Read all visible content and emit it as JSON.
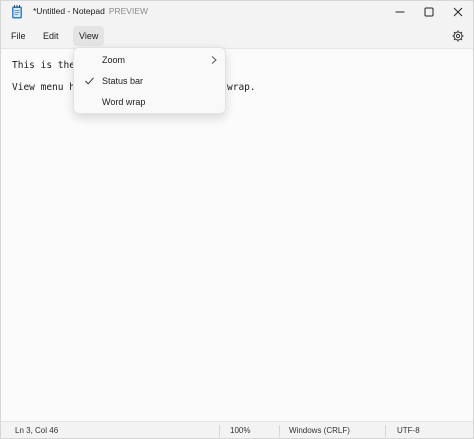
{
  "window": {
    "title": "*Untitled - Notepad",
    "preview_tag": "PREVIEW"
  },
  "menubar": {
    "file": "File",
    "edit": "Edit",
    "view": "View"
  },
  "editor": {
    "lines": [
      "This is the",
      "",
      "View menu h"
    ],
    "line3_tail": "wrap."
  },
  "view_menu": {
    "items": [
      {
        "label": "Zoom",
        "has_submenu": true,
        "checked": false
      },
      {
        "label": "Status bar",
        "has_submenu": false,
        "checked": true
      },
      {
        "label": "Word wrap",
        "has_submenu": false,
        "checked": false
      }
    ]
  },
  "statusbar": {
    "position": "Ln 3, Col 46",
    "zoom": "100%",
    "line_ending": "Windows (CRLF)",
    "encoding": "UTF-8"
  },
  "colors": {
    "menu_bg": "#f3f3f3",
    "editor_bg": "#fbfbfb",
    "icon_blue": "#3b82c4"
  }
}
